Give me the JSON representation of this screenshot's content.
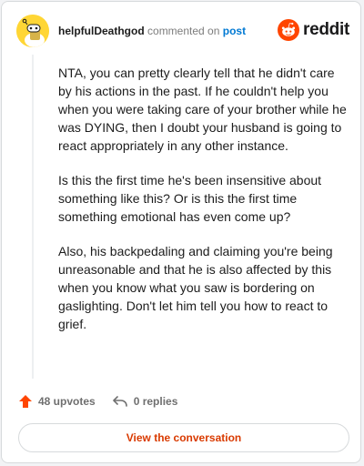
{
  "header": {
    "username": "helpfulDeathgod",
    "action_text": "commented on",
    "post_link": "post",
    "brand_name": "reddit"
  },
  "comment": {
    "paragraphs": [
      "NTA, you can pretty clearly tell that he didn't care by his actions in the past. If he couldn't help you when you were taking care of your brother while he was DYING, then I doubt your husband is going to react appropriately in any other instance.",
      "Is this the first time he's been insensitive about something like this? Or is this the first time something emotional has even come up?",
      "Also, his backpedaling and claiming you're being unreasonable and that he is also affected by this when you know what you saw is bordering on gaslighting. Don't let him tell you how to react to grief."
    ]
  },
  "actions": {
    "upvotes_label": "48 upvotes",
    "replies_label": "0 replies"
  },
  "cta": {
    "label": "View the conversation"
  },
  "icons": {
    "avatar": "snoo-avatar",
    "brand": "reddit-logo-icon",
    "upvote": "upvote-arrow-icon",
    "reply": "reply-arrow-icon"
  },
  "colors": {
    "accent": "#ff4500",
    "link": "#0079d3",
    "cta_text": "#d93a00",
    "avatar_bg": "#ffd635",
    "text": "#1c1c1c",
    "muted": "#7c7c7c"
  }
}
